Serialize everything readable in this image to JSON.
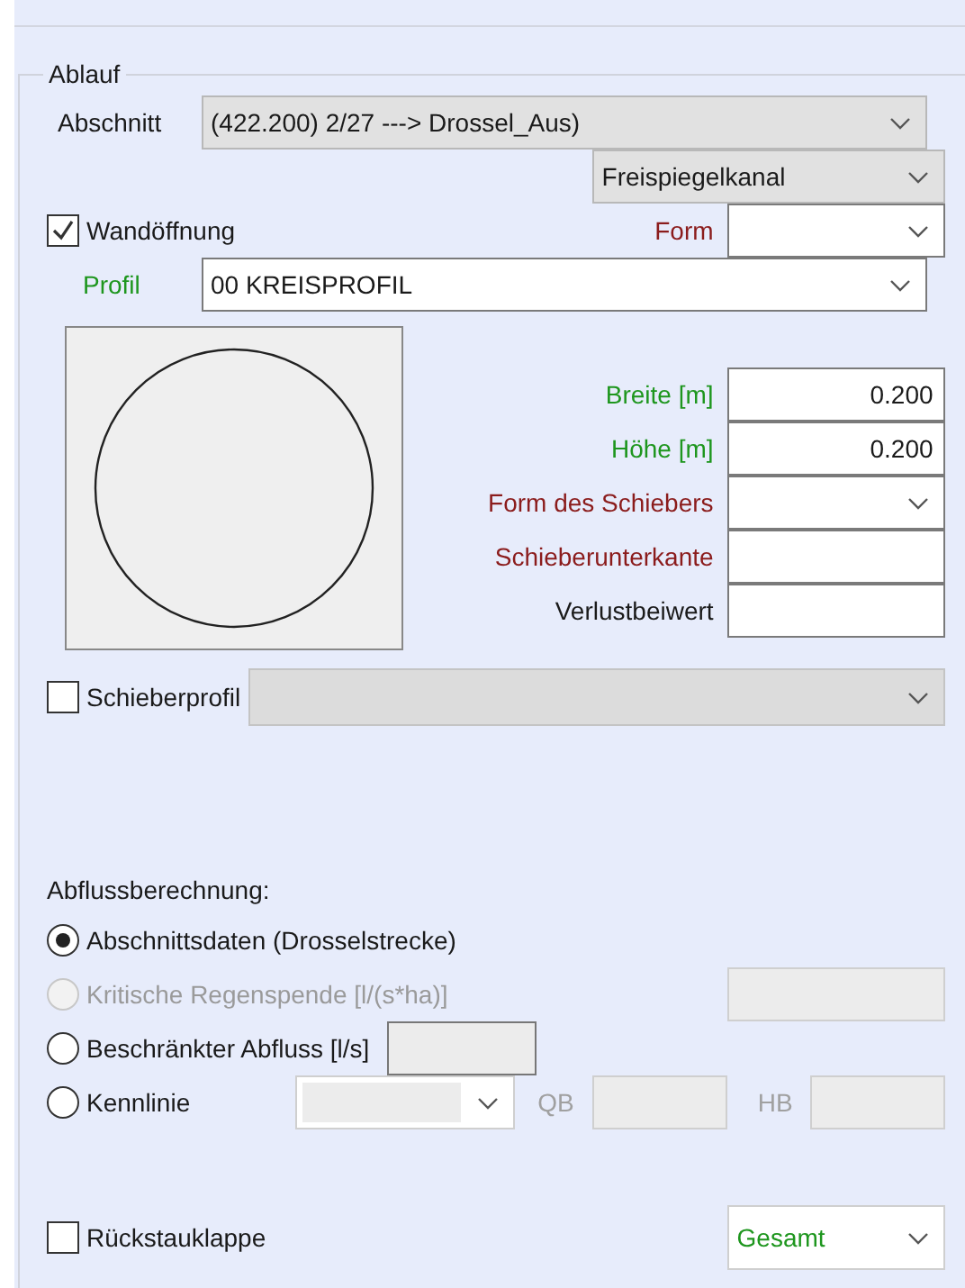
{
  "group": {
    "title": "Ablauf"
  },
  "section": {
    "label": "Abschnitt",
    "value": "(422.200) 2/27 ---> Drossel_Aus)"
  },
  "channel_type": {
    "value": "Freispiegelkanal"
  },
  "wall_opening": {
    "label": "Wandöffnung",
    "checked": true
  },
  "form": {
    "label": "Form",
    "color": "#8b1c1c"
  },
  "profile": {
    "label": "Profil",
    "color": "#1e961e",
    "value": "00 KREISPROFIL"
  },
  "preview": {
    "kind": "circle"
  },
  "fields": [
    {
      "kind": "number",
      "label": "Breite [m]",
      "color": "#1e961e",
      "value": "0.200"
    },
    {
      "kind": "number",
      "label": "Höhe [m]",
      "color": "#1e961e",
      "value": "0.200"
    },
    {
      "kind": "dropdown",
      "label": "Form des Schiebers",
      "color": "#8b1c1c"
    },
    {
      "kind": "text",
      "label": "Schieberunterkante",
      "color": "#8b1c1c"
    },
    {
      "kind": "text",
      "label": "Verlustbeiwert",
      "color": "#1a1a1a"
    }
  ],
  "gate_profile": {
    "label": "Schieberprofil",
    "checked": false
  },
  "discharge": {
    "heading": "Abflussberechnung:",
    "options": [
      {
        "kind": "plain",
        "label": "Abschnittsdaten (Drosselstrecke)",
        "selected": true,
        "disabled": false
      },
      {
        "kind": "rate_field",
        "label": "Kritische Regenspende [l/(s*ha)]",
        "selected": false,
        "disabled": true
      },
      {
        "kind": "flow_field",
        "label": "Beschränkter Abfluss [l/s]",
        "selected": false,
        "disabled": false
      },
      {
        "kind": "curve",
        "label": "Kennlinie",
        "selected": false,
        "disabled": false,
        "qb_label": "QB",
        "hb_label": "HB"
      }
    ]
  },
  "backflow_flap": {
    "label": "Rückstauklappe",
    "checked": false
  },
  "mode": {
    "value": "Gesamt"
  }
}
